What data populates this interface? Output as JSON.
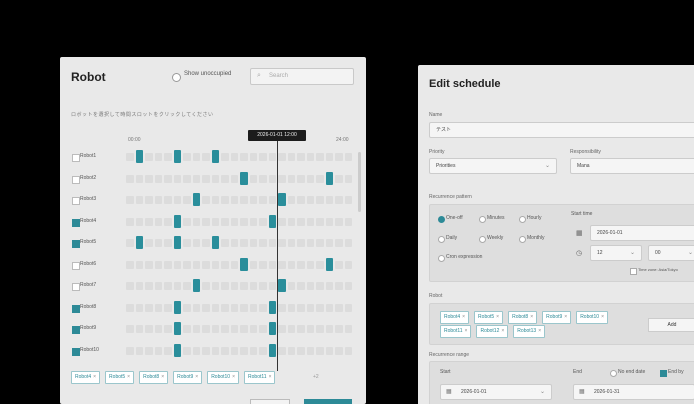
{
  "robot_panel": {
    "title": "Robot",
    "show_unoccupied_label": "Show unoccupied",
    "search_placeholder": "Search",
    "search_icon": "magnifier-icon",
    "description": "ロボットを選択して時間スロットをクリックしてください",
    "time_start": "00:00",
    "time_end": "24:00",
    "tooltip": "2026-01-01 12:00",
    "robots": [
      {
        "name": "Robot1",
        "checked": false,
        "slots": [
          1,
          5,
          9
        ]
      },
      {
        "name": "Robot2",
        "checked": false,
        "slots": [
          12,
          21
        ]
      },
      {
        "name": "Robot3",
        "checked": false,
        "slots": [
          7,
          16
        ]
      },
      {
        "name": "Robot4",
        "checked": true,
        "slots": [
          5,
          15
        ]
      },
      {
        "name": "Robot5",
        "checked": true,
        "slots": [
          1,
          5,
          9
        ]
      },
      {
        "name": "Robot6",
        "checked": false,
        "slots": [
          12,
          21
        ]
      },
      {
        "name": "Robot7",
        "checked": false,
        "slots": [
          7,
          16
        ]
      },
      {
        "name": "Robot8",
        "checked": true,
        "slots": [
          5,
          15
        ]
      },
      {
        "name": "Robot9",
        "checked": true,
        "slots": [
          5,
          15
        ]
      },
      {
        "name": "Robot10",
        "checked": true,
        "slots": [
          5,
          15
        ]
      }
    ],
    "selected_chips": [
      "Robot4",
      "Robot5",
      "Robot8",
      "Robot9",
      "Robot10",
      "Robot11"
    ],
    "more_text": "+2"
  },
  "schedule": {
    "title": "Edit schedule",
    "name_label": "Name",
    "name_value": "テスト",
    "priority_label": "Priority",
    "priority_value": "Priorities",
    "responsibility_label": "Responsibility",
    "responsibility_value": "Mana",
    "recurrence_label": "Recurrence pattern",
    "recurrence_options": [
      "One-off",
      "Minutes",
      "Hourly",
      "Daily",
      "Weekly",
      "Monthly"
    ],
    "custom_label": "Cron expression",
    "start_time_label": "Start time",
    "start_date": "2026-01-01",
    "hour": "12",
    "minute": "00",
    "timezone_note": "Time zone: Asia/Tokyo",
    "robots_label": "Robot",
    "robot_chips": [
      "Robot4",
      "Robot5",
      "Robot8",
      "Robot9",
      "Robot10",
      "Robot11",
      "Robot12",
      "Robot13"
    ],
    "add_label": "Add",
    "range_label": "Recurrence range",
    "start_label": "Start",
    "end_label": "End",
    "range_start": "2026-01-01",
    "range_end": "2026-01-31",
    "no_end_label": "No end date",
    "end_by_label": "End by"
  }
}
